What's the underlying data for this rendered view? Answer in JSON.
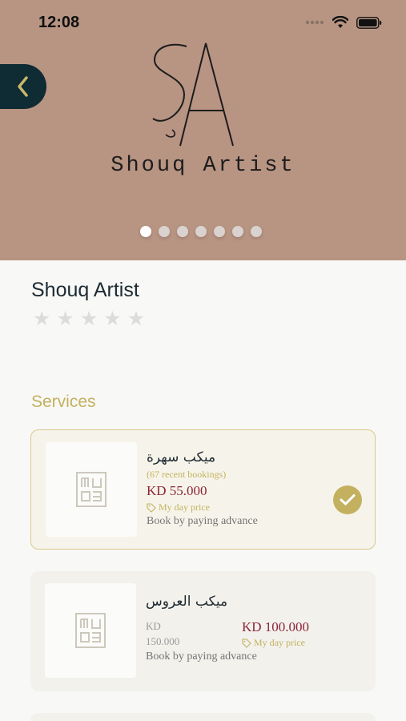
{
  "status_bar": {
    "time": "12:08"
  },
  "hero": {
    "brand_monogram": "SA",
    "brand_name": "Shouq Artist",
    "carousel": {
      "count": 7,
      "active_index": 0
    }
  },
  "artist": {
    "name": "Shouq Artist",
    "rating": 0,
    "max_rating": 5
  },
  "services": {
    "title": "Services",
    "items": [
      {
        "name": "ميكب سهرة",
        "bookings": "(67 recent bookings)",
        "price": "KD 55.000",
        "day_price_label": "My day price",
        "payment_note": "Book by paying advance",
        "selected": true
      },
      {
        "name": "ميكب العروس",
        "old_price_currency": "KD",
        "old_price_amount": "150.000",
        "price": "KD 100.000",
        "day_price_label": "My day price",
        "payment_note": "Book by paying advance",
        "selected": false
      }
    ]
  },
  "colors": {
    "hero_bg": "#b89482",
    "accent_gold": "#c3b15f",
    "price_red": "#8d2435",
    "back_button": "#0f2b33"
  }
}
